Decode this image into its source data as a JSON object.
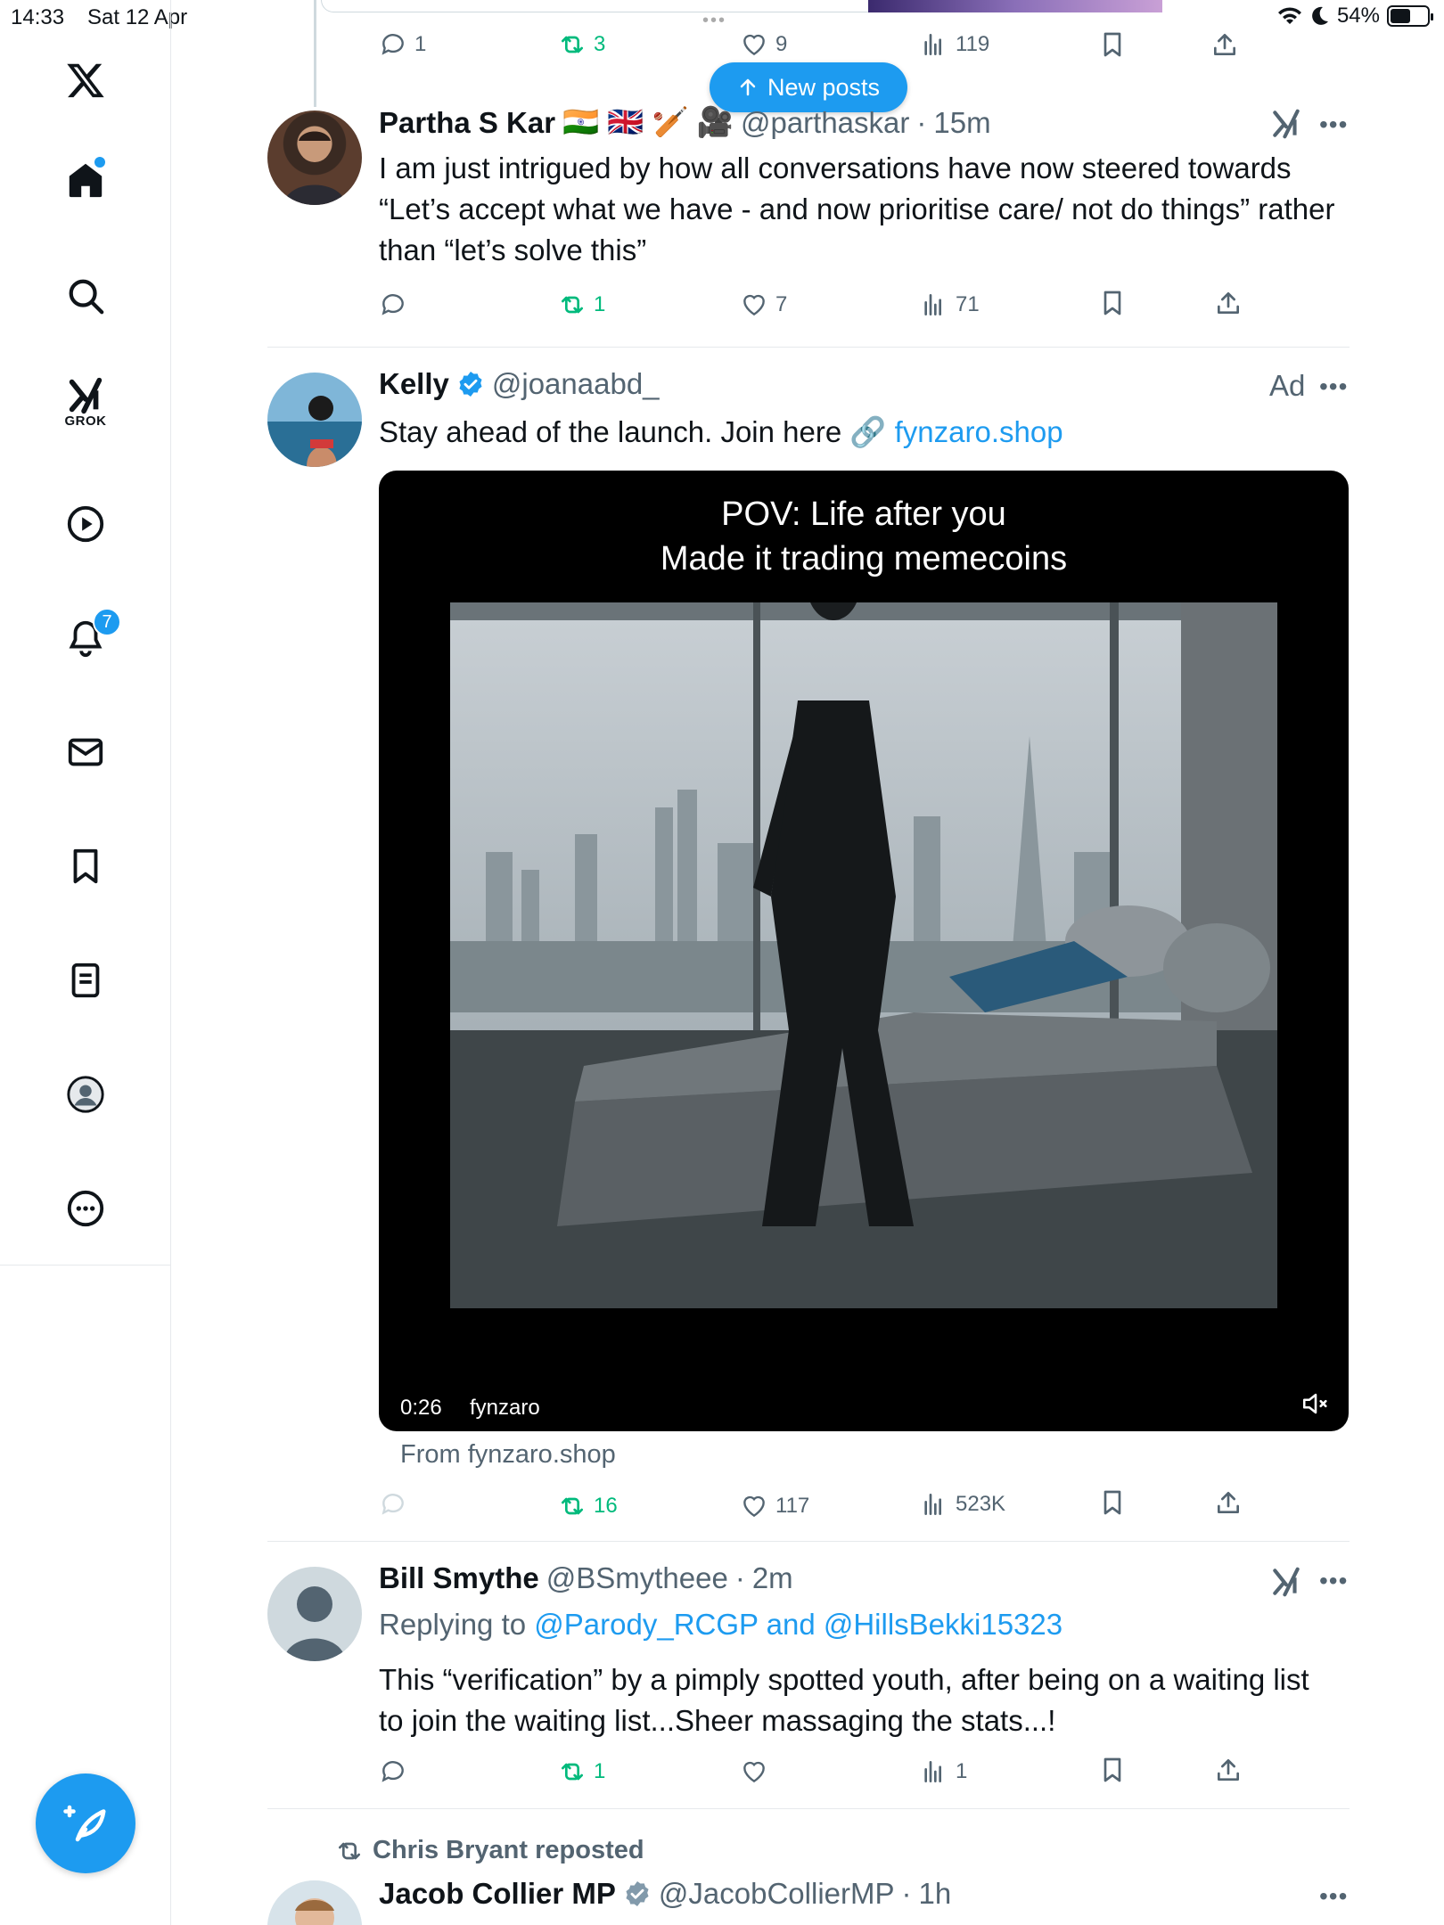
{
  "status": {
    "time": "14:33",
    "date": "Sat 12 Apr",
    "battery": "54%",
    "battery_level": 0.54
  },
  "sidebar": {
    "logo": "x-logo-icon",
    "items": [
      {
        "name": "home",
        "icon": "home-icon",
        "has_dot": true
      },
      {
        "name": "search",
        "icon": "search-icon"
      },
      {
        "name": "grok",
        "icon": "grok-icon",
        "label": "GROK"
      },
      {
        "name": "videos",
        "icon": "play-icon"
      },
      {
        "name": "notifications",
        "icon": "bell-icon",
        "badge": "7"
      },
      {
        "name": "messages",
        "icon": "mail-icon"
      },
      {
        "name": "bookmarks",
        "icon": "bookmark-icon"
      },
      {
        "name": "lists",
        "icon": "list-icon"
      },
      {
        "name": "profile",
        "icon": "profile-icon"
      },
      {
        "name": "more",
        "icon": "more-circle-icon"
      }
    ],
    "compose": "compose-icon"
  },
  "new_posts_label": "New posts",
  "prev_tweet": {
    "replies": "1",
    "reposts": "3",
    "likes": "9",
    "views": "119"
  },
  "tweets": [
    {
      "name": "Partha S Kar",
      "emojis": "🇮🇳 🇬🇧 🏏 🎥",
      "handle": "@parthaskar",
      "time": "15m",
      "text": "I am just intrigued by how all conversations have now steered towards “Let’s accept what we have - and now prioritise care/ not do things” rather than “let’s solve this”",
      "reposts": "1",
      "likes": "7",
      "views": "71"
    },
    {
      "name": "Kelly",
      "handle": "@joanaabd_",
      "ad_label": "Ad",
      "text_prefix": "Stay ahead of the launch. Join here 🔗",
      "link_text": "fynzaro.shop",
      "video_caption_line1": "POV: Life after you",
      "video_caption_line2": "Made it trading memecoins",
      "video_time": "0:26",
      "video_source": "fynzaro",
      "from_label": "From fynzaro.shop",
      "reposts": "16",
      "likes": "117",
      "views": "523K"
    },
    {
      "name": "Bill Smythe",
      "handle": "@BSmytheee",
      "time": "2m",
      "replying_prefix": "Replying to",
      "replying_to": "@Parody_RCGP and @HillsBekki15323",
      "text": "This “verification” by a pimply spotted youth, after being on a waiting list to join the waiting list...Sheer massaging the stats...!",
      "reposts": "1",
      "views": "1"
    },
    {
      "repost_by": "Chris Bryant reposted",
      "name": "Jacob Collier MP",
      "handle": "@JacobCollierMP",
      "time": "1h"
    }
  ],
  "colors": {
    "accent": "#1d9bf0",
    "repost_green": "#00ba7c",
    "secondary_text": "#536471"
  }
}
